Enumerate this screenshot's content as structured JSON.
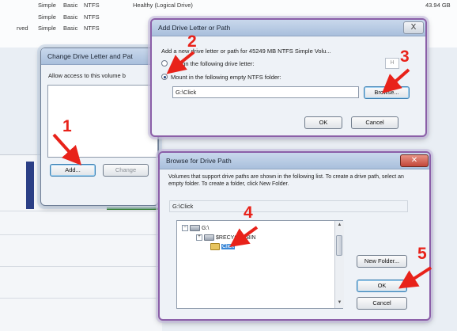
{
  "colors": {
    "annotation": "#e8221a",
    "titlebar": "#a9bfdc",
    "purple_border": "#8b5fa8"
  },
  "background": {
    "rows": [
      {
        "prefix": "",
        "layout": "Simple",
        "type": "Basic",
        "fs": "NTFS",
        "status": "Healthy (Logical Drive)",
        "cap": "43.94 GB"
      },
      {
        "prefix": "",
        "layout": "Simple",
        "type": "Basic",
        "fs": "NTFS",
        "status": "",
        "cap": ""
      },
      {
        "prefix": "rved",
        "layout": "Simple",
        "type": "Basic",
        "fs": "NTFS",
        "status": "",
        "cap": ""
      }
    ]
  },
  "change_dialog": {
    "title": "Change Drive Letter and Pat",
    "desc": "Allow access to this volume b",
    "add_label": "Add...",
    "change_label": "Change"
  },
  "add_dialog": {
    "title": "Add Drive Letter or Path",
    "close_label": "X",
    "desc": "Add a new drive letter or path for 45249 MB NTFS Simple Volu...",
    "radio1_label": "Assign the following drive letter:",
    "radio2_label": "Mount in the following empty NTFS folder:",
    "path_value": "G:\\Click",
    "letter_value": "H",
    "browse_label": "Browse...",
    "ok_label": "OK",
    "cancel_label": "Cancel"
  },
  "browse_dialog": {
    "title": "Browse for Drive Path",
    "desc": "Volumes that support drive paths are shown in the following list. To create a drive path, select an empty folder. To create a folder, click New Folder.",
    "path_value": "G:\\Click",
    "tree": [
      {
        "label": "G:\\",
        "icon": "drive-icon",
        "expander": "−"
      },
      {
        "label": "$RECYCLE.BIN",
        "icon": "drive-icon",
        "expander": "+"
      },
      {
        "label": "Click",
        "icon": "folder-icon",
        "expander": ""
      }
    ],
    "new_folder_label": "New Folder...",
    "ok_label": "OK",
    "cancel_label": "Cancel"
  },
  "annotations": [
    "1",
    "2",
    "3",
    "4",
    "5"
  ]
}
